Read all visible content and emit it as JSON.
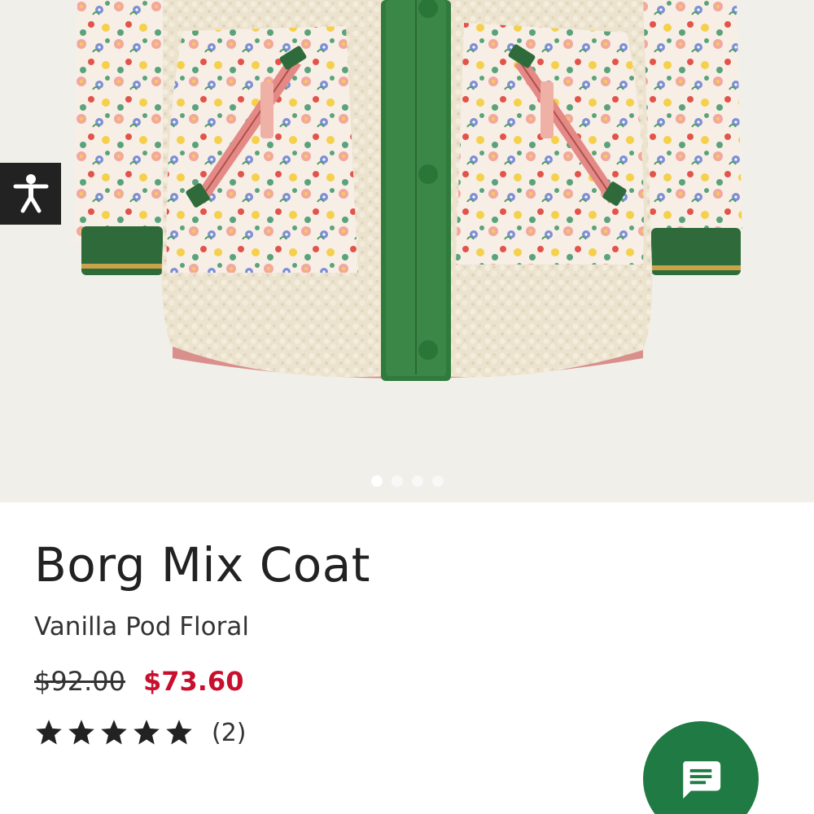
{
  "product": {
    "name": "Borg Mix Coat",
    "variant": "Vanilla Pod Floral",
    "price_original": "$92.00",
    "price_sale": "$73.60",
    "rating": 5,
    "rating_max": 5,
    "review_count": "(2)"
  },
  "gallery": {
    "image_count": 4,
    "active_index": 0,
    "image_subject": "coat-photo"
  },
  "icons": {
    "accessibility": "accessibility-icon",
    "chat": "chat-icon",
    "star": "star-icon"
  },
  "colors": {
    "sale_price": "#c8102e",
    "chat_button": "#1f7a43",
    "accessibility_button": "#222222",
    "gallery_background": "#f1efea"
  }
}
